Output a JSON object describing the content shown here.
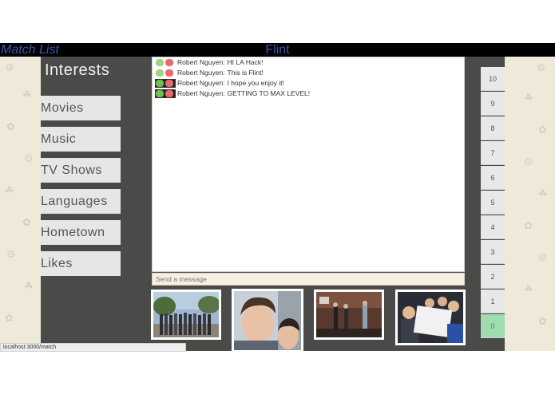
{
  "header": {
    "match_list_label": "Match List",
    "app_title": "Flint"
  },
  "sidebar": {
    "title": "Interests",
    "items": [
      {
        "label": "Movies"
      },
      {
        "label": "Music"
      },
      {
        "label": "TV Shows"
      },
      {
        "label": "Languages"
      },
      {
        "label": "Hometown"
      },
      {
        "label": "Likes"
      }
    ]
  },
  "chat": {
    "messages": [
      {
        "sender": "Robert Nguyen:",
        "text": "HI LA Hack!"
      },
      {
        "sender": "Robert Nguyen:",
        "text": "This is Flint!"
      },
      {
        "sender": "Robert Nguyen:",
        "text": "I hope you enjoy it!"
      },
      {
        "sender": "Robert Nguyen:",
        "text": "GETTING TO MAX LEVEL!"
      }
    ],
    "input_placeholder": "Send a message"
  },
  "level_scale": {
    "ticks": [
      "10",
      "9",
      "8",
      "7",
      "6",
      "5",
      "4",
      "3",
      "2",
      "1",
      "0"
    ],
    "selected": "0"
  },
  "status_bar": {
    "url": "localhost:3000/match"
  },
  "colors": {
    "accent_text": "#3b56b0",
    "panel": "#4a4a48",
    "selected_level": "#9fdcb0"
  }
}
